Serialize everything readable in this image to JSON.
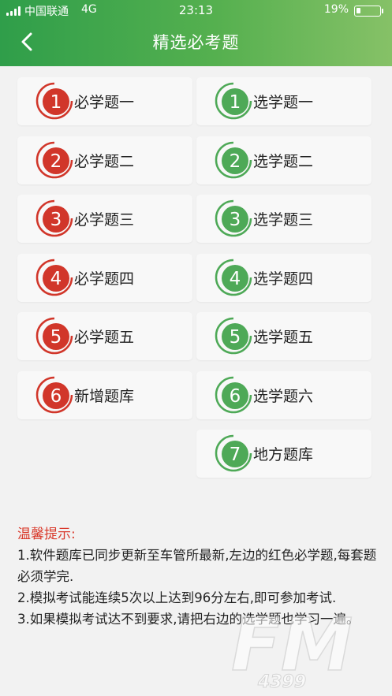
{
  "status_bar": {
    "carrier": "中国联通",
    "network": "4G",
    "time": "23:13",
    "battery_pct": "19%",
    "battery_level": 0.19
  },
  "header": {
    "title": "精选必考题",
    "back_icon": "chevron-left-icon"
  },
  "colors": {
    "required": "#d1362a",
    "elective": "#4ea957",
    "tips_title": "#d9392b"
  },
  "required_items": [
    {
      "num": "1",
      "label": "必学题一"
    },
    {
      "num": "2",
      "label": "必学题二"
    },
    {
      "num": "3",
      "label": "必学题三"
    },
    {
      "num": "4",
      "label": "必学题四"
    },
    {
      "num": "5",
      "label": "必学题五"
    },
    {
      "num": "6",
      "label": "新增题库"
    }
  ],
  "elective_items": [
    {
      "num": "1",
      "label": "选学题一"
    },
    {
      "num": "2",
      "label": "选学题二"
    },
    {
      "num": "3",
      "label": "选学题三"
    },
    {
      "num": "4",
      "label": "选学题四"
    },
    {
      "num": "5",
      "label": "选学题五"
    },
    {
      "num": "6",
      "label": "选学题六"
    },
    {
      "num": "7",
      "label": "地方题库"
    }
  ],
  "tips": {
    "title": "温馨提示:",
    "lines": [
      "1.软件题库已同步更新至车管所最新,左边的红色必学题,每套题必须学完.",
      "2.模拟考试能连续5次以上达到96分左右,即可参加考试.",
      "3.如果模拟考试达不到要求,请把右边的选学题也学习一遍。"
    ]
  },
  "watermark": {
    "text": "FM",
    "subtext": "4399"
  }
}
